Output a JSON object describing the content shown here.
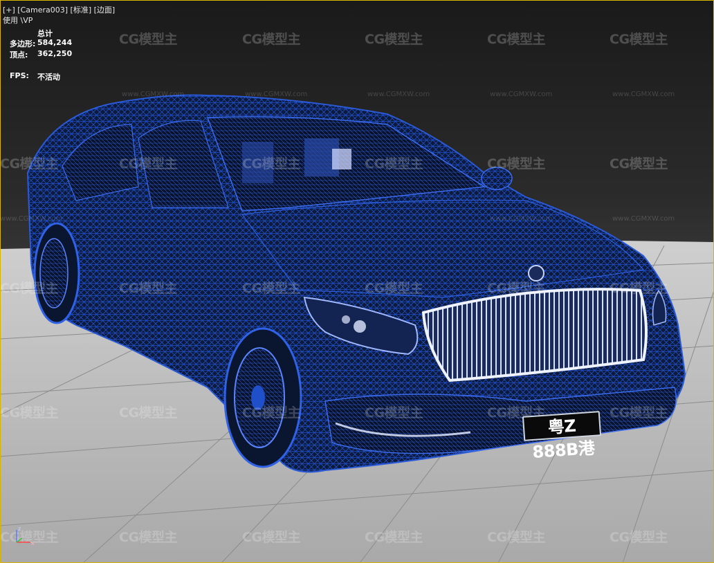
{
  "viewport": {
    "label_bar": "[+] [Camera003] [标准] [边面]",
    "label_sub": "使用 \\VP"
  },
  "stats": {
    "header": "总计",
    "polygons_label": "多边形:",
    "polygons_value": "584,244",
    "vertices_label": "顶点:",
    "vertices_value": "362,250",
    "fps_label": "FPS:",
    "fps_value": "不活动"
  },
  "license_plate": "粤Z 888B港",
  "watermark": {
    "logo_text": "CG模型主",
    "url_text": "www.CGMXW.com"
  },
  "gizmo": {
    "axis_x": "x",
    "axis_z": "z"
  },
  "colors": {
    "selection_border": "#d6b400",
    "wire_blue": "#1f4fc9",
    "car_body": "#0d1a3a",
    "floor": "#b7b7b7"
  }
}
